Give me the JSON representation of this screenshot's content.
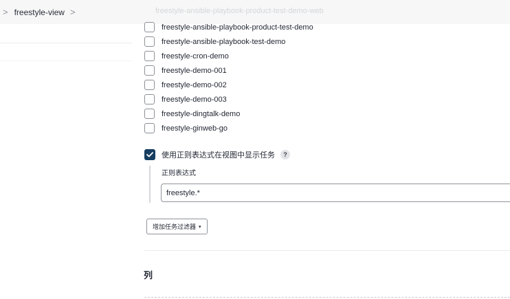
{
  "breadcrumb": {
    "separator": ">",
    "current": "freestyle-view"
  },
  "faded_row_text": "freestyle-ansible-playbook-product-test-demo-web",
  "job_list": [
    {
      "name": "freestyle-ansible-playbook-product-test-demo",
      "checked": false
    },
    {
      "name": "freestyle-ansible-playbook-test-demo",
      "checked": false
    },
    {
      "name": "freestyle-cron-demo",
      "checked": false
    },
    {
      "name": "freestyle-demo-001",
      "checked": false
    },
    {
      "name": "freestyle-demo-002",
      "checked": false
    },
    {
      "name": "freestyle-demo-003",
      "checked": false
    },
    {
      "name": "freestyle-dingtalk-demo",
      "checked": false
    },
    {
      "name": "freestyle-ginweb-go",
      "checked": false
    }
  ],
  "regex_filter": {
    "checked": true,
    "label": "使用正则表达式在视图中显示任务",
    "help": "?",
    "field_label": "正则表达式",
    "value": "freestyle.*"
  },
  "add_filter_button": {
    "label": "增加任务过滤器",
    "caret": "▾"
  },
  "columns_heading": "列",
  "colors": {
    "checkbox_checked": "#163d60",
    "breadcrumb_bg": "#f7f7f7"
  }
}
